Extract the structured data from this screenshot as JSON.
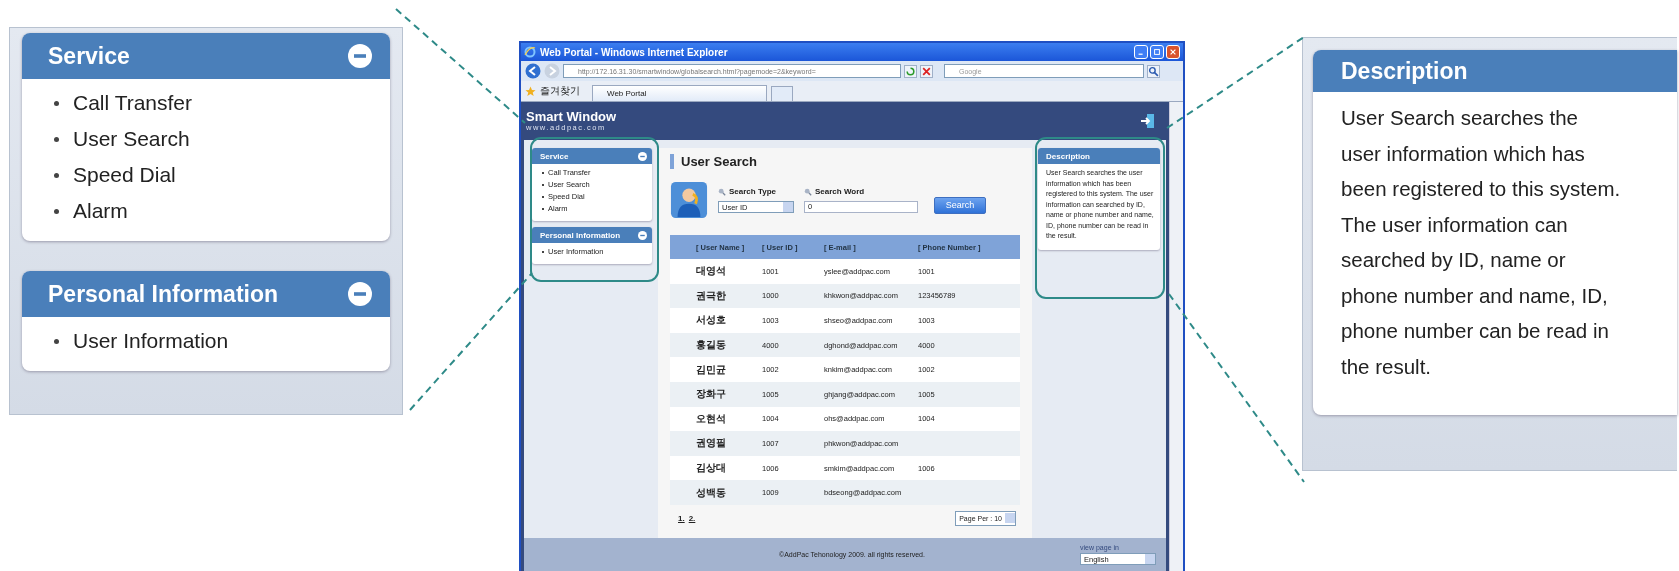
{
  "callout_left": {
    "panels": [
      {
        "title": "Service",
        "items": [
          "Call Transfer",
          "User Search",
          "Speed Dial",
          "Alarm"
        ]
      },
      {
        "title": "Personal Information",
        "items": [
          "User Information"
        ]
      }
    ]
  },
  "browser": {
    "title": "Web Portal - Windows Internet Explorer",
    "address": "http://172.16.31.30/smartwindow/globalsearch.html?pagemode=2&keyword=",
    "search_placeholder": "Google",
    "favorites": "즐겨찾기",
    "tab": "Web Portal"
  },
  "site": {
    "logo": "Smart Window",
    "logo_sub": "www.addpac.com"
  },
  "sidebar": {
    "panels": [
      {
        "title": "Service",
        "items": [
          "Call Transfer",
          "User Search",
          "Speed Dial",
          "Alarm"
        ]
      },
      {
        "title": "Personal Information",
        "items": [
          "User Information"
        ]
      }
    ]
  },
  "main": {
    "heading": "User Search",
    "search_type_label": "Search Type",
    "search_type_value": "User ID",
    "search_word_label": "Search Word",
    "search_word_value": "0",
    "search_button": "Search"
  },
  "table": {
    "columns": [
      "[ User Name ]",
      "[ User ID ]",
      "[ E-mail ]",
      "[ Phone Number ]"
    ],
    "rows": [
      [
        "대영석",
        "1001",
        "yslee@addpac.com",
        "1001"
      ],
      [
        "권극한",
        "1000",
        "khkwon@addpac.com",
        "123456789"
      ],
      [
        "서성호",
        "1003",
        "shseo@addpac.com",
        "1003"
      ],
      [
        "홍길동",
        "4000",
        "dghond@addpac.com",
        "4000"
      ],
      [
        "김민균",
        "1002",
        "knkim@addpac.com",
        "1002"
      ],
      [
        "장화구",
        "1005",
        "ghjang@addpac.com",
        "1005"
      ],
      [
        "오현석",
        "1004",
        "ohs@addpac.com",
        "1004"
      ],
      [
        "권영필",
        "1007",
        "phkwon@addpac.com",
        ""
      ],
      [
        "김상대",
        "1006",
        "smkim@addpac.com",
        "1006"
      ],
      [
        "성백동",
        "1009",
        "bdseong@addpac.com",
        ""
      ]
    ]
  },
  "pagination": {
    "pages": [
      "1.",
      "2."
    ],
    "page_per": "Page Per : 10"
  },
  "description": {
    "title": "Description",
    "text": "User Search searches the user information which has been registered to this system. The user information can searched by ID, name or phone number and name, ID, phone number can be read in the result."
  },
  "footer": {
    "copyright": "©AddPac Tehonology 2009. all rights reserved.",
    "language_label": "view page in",
    "language": "English"
  },
  "callout_right": {
    "title": "Description",
    "text": "User Search searches the user information which has been registered to this system. The user information can searched by ID, name or phone number and name, ID, phone number can be read in the result."
  }
}
